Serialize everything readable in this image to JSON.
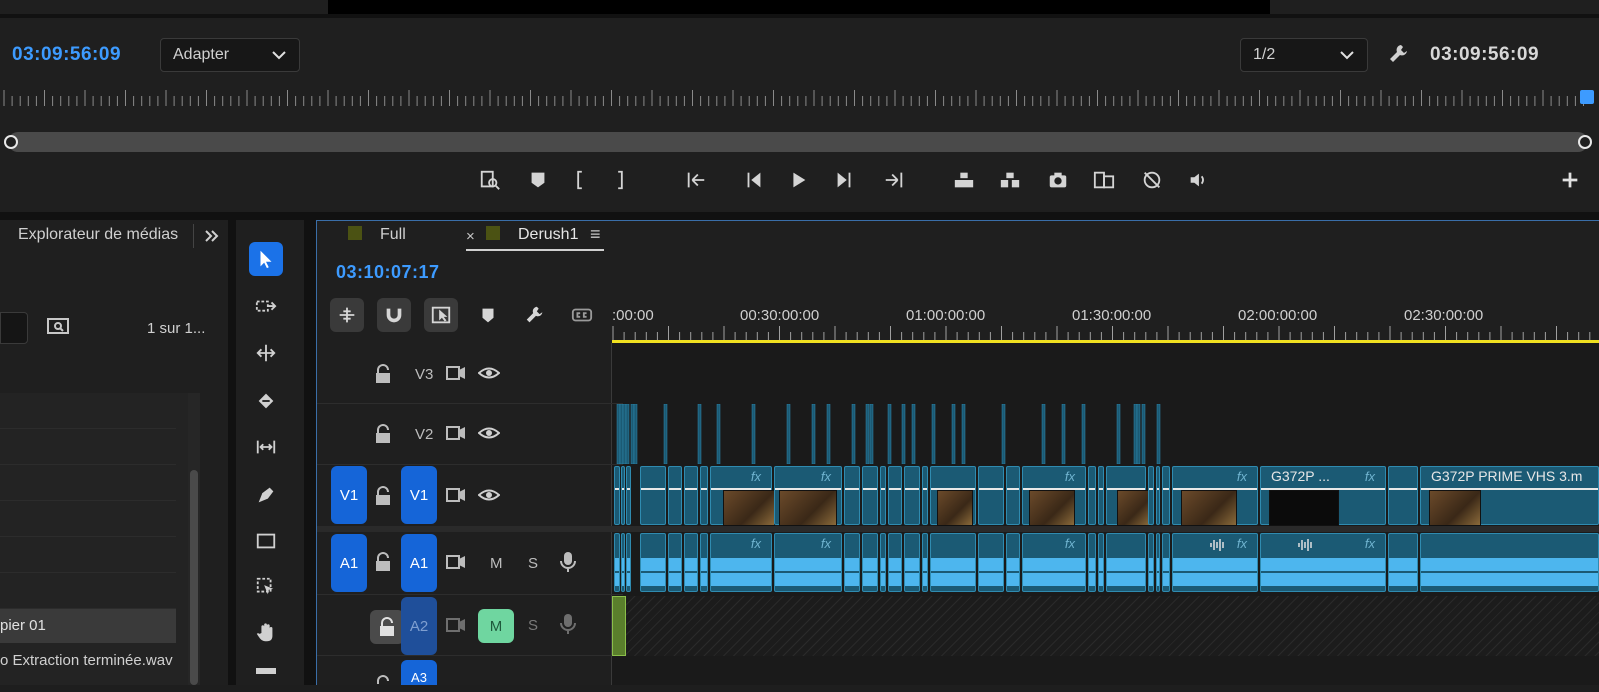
{
  "monitor": {
    "timecode_left": "03:09:56:09",
    "zoom_select": "Adapter",
    "resolution_select": "1/2",
    "timecode_right": "03:09:56:09",
    "transport_buttons": [
      "export-frame-settings-icon",
      "add-marker-icon",
      "mark-in-icon",
      "mark-out-icon",
      "go-to-in-icon",
      "step-back-icon",
      "play-icon",
      "step-forward-icon",
      "go-to-out-icon",
      "lift-icon",
      "extract-icon",
      "camera-icon",
      "comparison-view-icon",
      "vr-icon",
      "audio-icon",
      "add-button-icon"
    ]
  },
  "left_panel": {
    "tab_label": "Explorateur de médias",
    "count_label": "1 sur 1...",
    "item_1": "pier 01",
    "item_2": "o Extraction terminée.wav"
  },
  "timeline": {
    "tab_full": "Full",
    "tab_close": "×",
    "tab_derush": "Derush1",
    "menu_icon": "≡",
    "timecode": "03:10:07:17",
    "ruler_labels": [
      ":00:00",
      "00:30:00:00",
      "01:00:00:00",
      "01:30:00:00",
      "02:00:00:00",
      "02:30:00:00"
    ],
    "tracks": {
      "v3": "V3",
      "v2": "V2",
      "v1_src": "V1",
      "v1": "V1",
      "a1_src": "A1",
      "a1": "A1",
      "a2": "A2",
      "a3": "A3",
      "mute": "M",
      "solo": "S"
    },
    "clip_fx": "fx",
    "clip_name_1": "G372P ...",
    "clip_name_2": "G372P PRIME VHS 3.m",
    "colors": {
      "accent": "#3d9bff",
      "track_blue": "#1565d8",
      "clip": "#1b5a74",
      "audio": "#4db6ee",
      "mute_on": "#6fd6a0",
      "playbar": "#f0e020"
    }
  }
}
